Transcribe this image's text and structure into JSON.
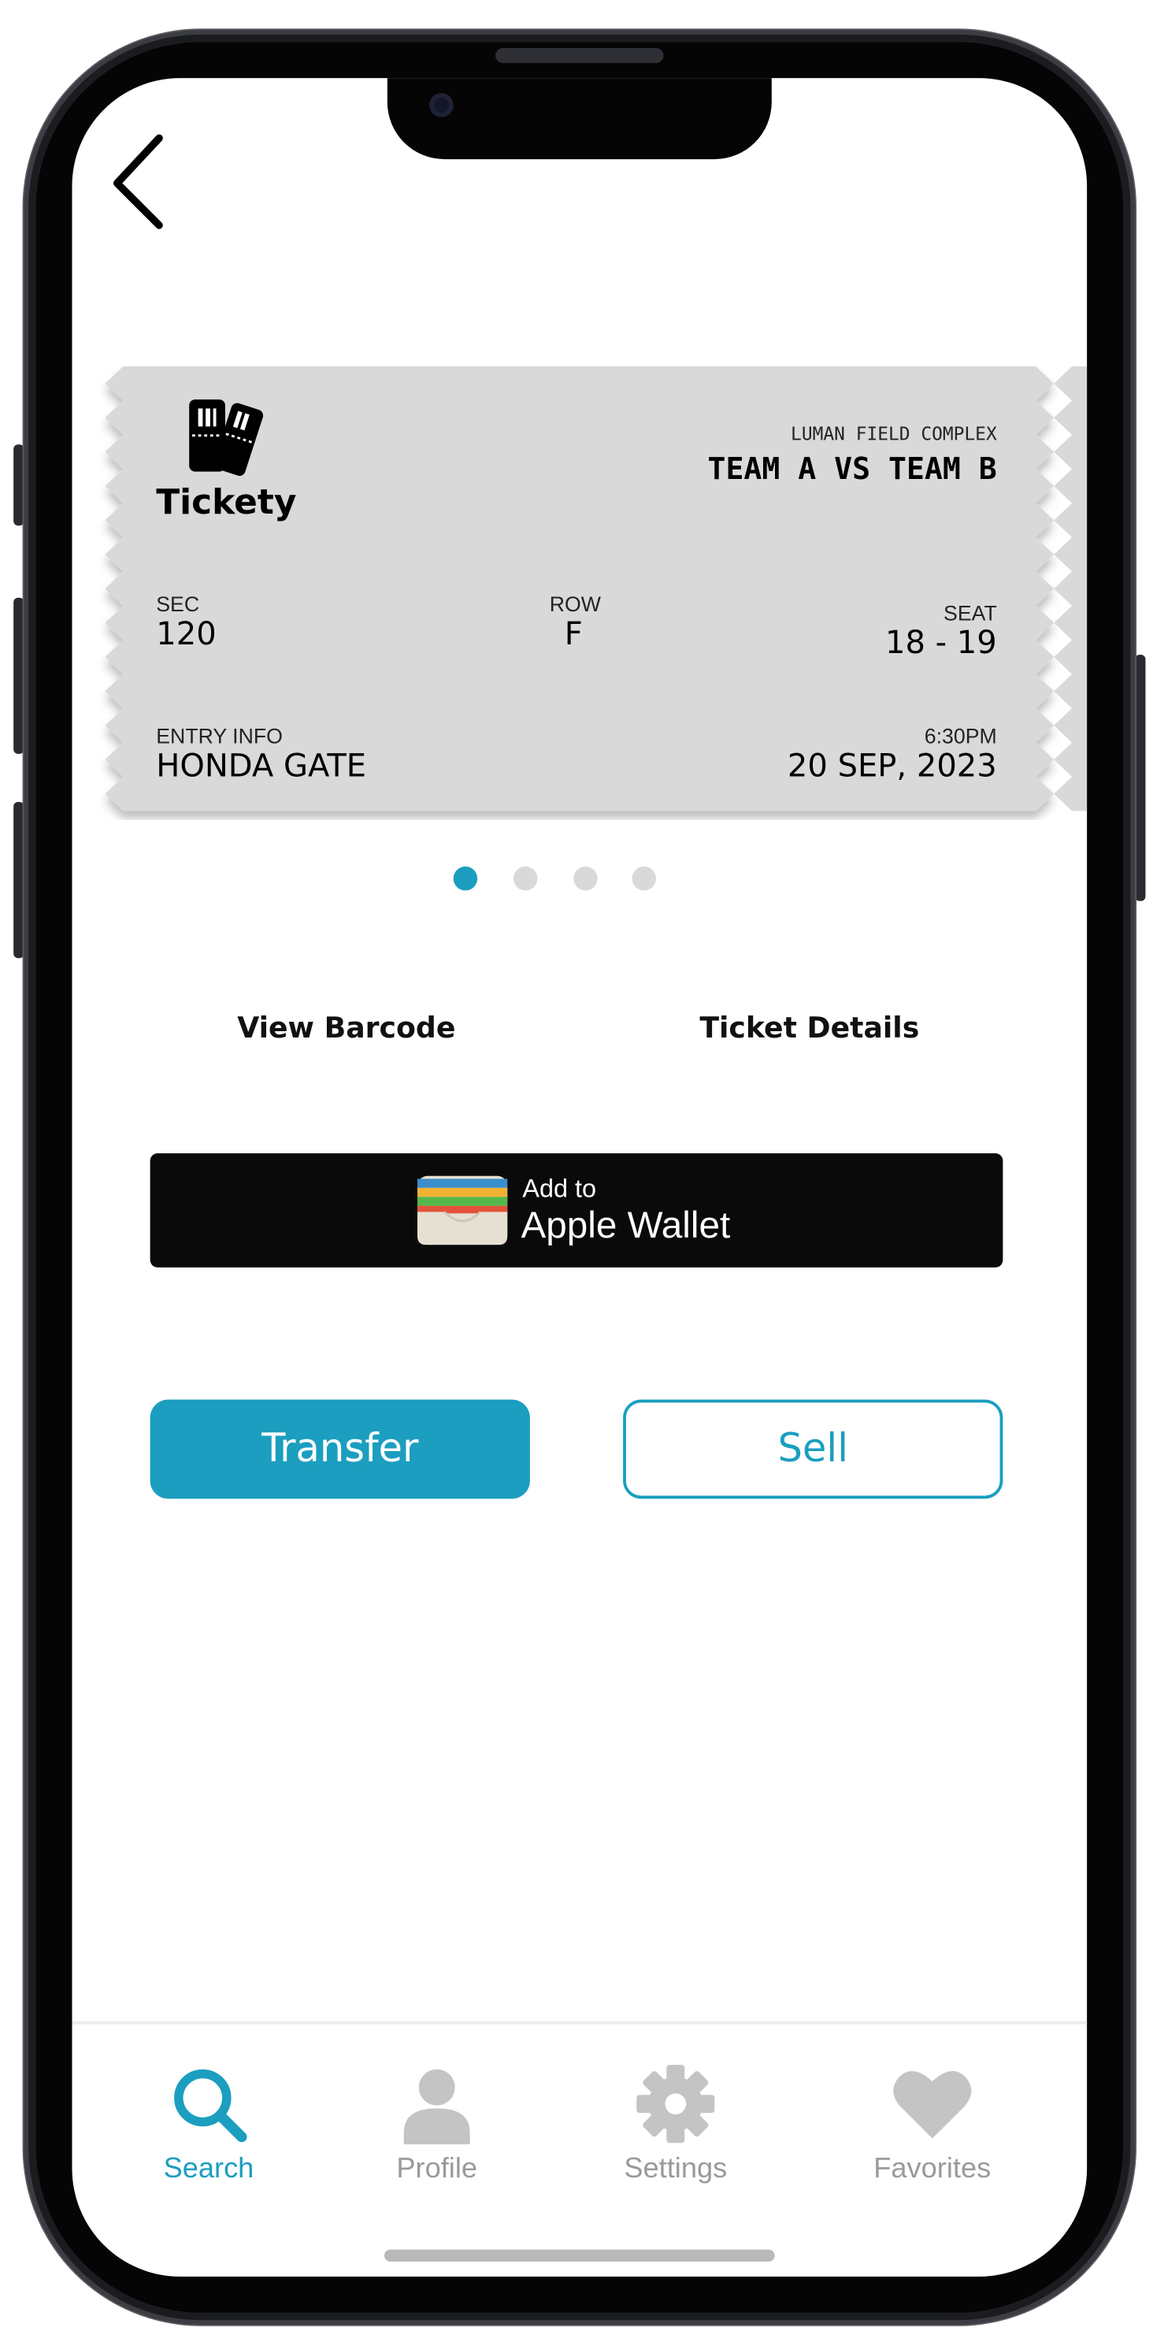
{
  "ticket": {
    "brand": "Tickety",
    "venue": "LUMAN FIELD COMPLEX",
    "event": "TEAM A VS TEAM B",
    "sec_label": "SEC",
    "sec_value": "120",
    "row_label": "ROW",
    "row_value": "F",
    "seat_label": "SEAT",
    "seat_value": "18 - 19",
    "entry_label": "ENTRY INFO",
    "entry_value": "HONDA GATE",
    "time": "6:30PM",
    "date": "20 SEP, 2023",
    "color": "#d9d9d9"
  },
  "pager": {
    "count": 4,
    "active_index": 0
  },
  "links": {
    "view_barcode": "View Barcode",
    "ticket_details": "Ticket Details"
  },
  "wallet": {
    "line1": "Add to",
    "line2": "Apple Wallet"
  },
  "actions": {
    "transfer": "Transfer",
    "sell": "Sell"
  },
  "tabs": [
    {
      "label": "Search",
      "icon": "search-icon",
      "active": true
    },
    {
      "label": "Profile",
      "icon": "person-icon",
      "active": false
    },
    {
      "label": "Settings",
      "icon": "gear-icon",
      "active": false
    },
    {
      "label": "Favorites",
      "icon": "heart-icon",
      "active": false
    }
  ],
  "colors": {
    "accent": "#1b9ebf",
    "inactive": "#9a9a9a",
    "wallet_bg": "#0a0a0a"
  }
}
